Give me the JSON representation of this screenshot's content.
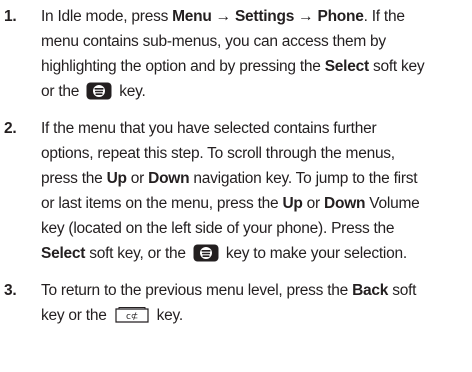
{
  "steps": [
    {
      "number": "1.",
      "lines": [
        [
          {
            "t": "In Idle mode, press "
          },
          {
            "t": "Menu",
            "b": true
          },
          {
            "t": " → ",
            "b": true
          },
          {
            "t": "Settings",
            "b": true
          },
          {
            "t": " → ",
            "b": true
          },
          {
            "t": "Phone",
            "b": true
          },
          {
            "t": ". If the"
          }
        ],
        [
          {
            "t": "menu contains sub-menus, you can access them by"
          }
        ],
        [
          {
            "t": "highlighting the option and by pressing the "
          },
          {
            "t": "Select",
            "b": true
          },
          {
            "t": " soft key"
          }
        ],
        [
          {
            "t": "or the "
          },
          {
            "icon": "select-key-icon"
          },
          {
            "t": " key."
          }
        ]
      ]
    },
    {
      "number": "2.",
      "lines": [
        [
          {
            "t": "If the menu that you have selected contains further"
          }
        ],
        [
          {
            "t": "options, repeat this step. To scroll through the menus,"
          }
        ],
        [
          {
            "t": "press the "
          },
          {
            "t": "Up",
            "b": true
          },
          {
            "t": " or "
          },
          {
            "t": "Down",
            "b": true
          },
          {
            "t": " navigation key. To jump to the first"
          }
        ],
        [
          {
            "t": "or last items on the menu, press the "
          },
          {
            "t": "Up",
            "b": true
          },
          {
            "t": " or "
          },
          {
            "t": "Down",
            "b": true
          },
          {
            "t": " Volume"
          }
        ],
        [
          {
            "t": "key (located on the left side of your phone). Press the"
          }
        ],
        [
          {
            "t": "Select",
            "b": true
          },
          {
            "t": " soft key, or the "
          },
          {
            "icon": "select-key-icon"
          },
          {
            "t": " key to make your selection."
          }
        ]
      ]
    },
    {
      "number": "3.",
      "lines": [
        [
          {
            "t": "To return to the previous menu level, press the "
          },
          {
            "t": "Back",
            "b": true
          },
          {
            "t": " soft"
          }
        ],
        [
          {
            "t": "key or the "
          },
          {
            "icon": "back-key-icon"
          },
          {
            "t": " key."
          }
        ]
      ]
    }
  ]
}
